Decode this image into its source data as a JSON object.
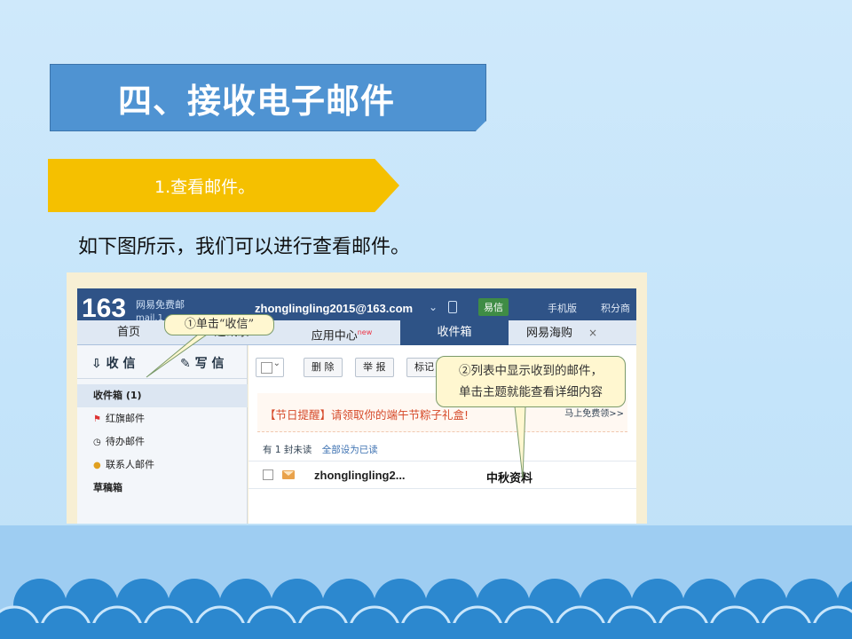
{
  "slide": {
    "title": "四、接收电子邮件",
    "step": "1.查看邮件。",
    "intro": "如下图所示，我们可以进行查看邮件。"
  },
  "mail": {
    "logo": "163",
    "logo_sub": "网易免费邮",
    "logo_mail": "mail.1",
    "account": "zhonglingling2015@163.com",
    "yixin": "易信",
    "header_links": [
      "手机版",
      "积分商"
    ],
    "tabs": [
      "首页",
      "通讯录",
      "应用中心",
      "收件箱",
      "网易海购"
    ],
    "tab_hot": "new",
    "active_tab": "收件箱",
    "compose": {
      "receive": "收 信",
      "write": "写 信"
    },
    "folders": [
      {
        "icon": "",
        "label": "收件箱 (1)"
      },
      {
        "icon": "flag-icon",
        "label": "红旗邮件"
      },
      {
        "icon": "clock-icon",
        "label": "待办邮件"
      },
      {
        "icon": "person-icon",
        "label": "联系人邮件"
      },
      {
        "icon": "",
        "label": "草稿箱"
      }
    ],
    "toolbar": {
      "delete": "删 除",
      "report": "举 报",
      "mark": "标记"
    },
    "notice": "【节日提醒】请领取你的端午节粽子礼盒!",
    "notice_link": "马上免费领>>",
    "unread_text": "有 1 封未读",
    "mark_all_read": "全部设为已读",
    "row": {
      "sender": "zhonglingling2...",
      "subject": "中秋资料"
    }
  },
  "callouts": {
    "one": "①单击“收信”",
    "two_line1": "②列表中显示收到的邮件，",
    "two_line2": "单击主题就能查看详细内容"
  },
  "colors": {
    "title_blue": "#4f93d2",
    "step_yellow": "#f5c000",
    "wave_blue": "#2c88cf"
  }
}
